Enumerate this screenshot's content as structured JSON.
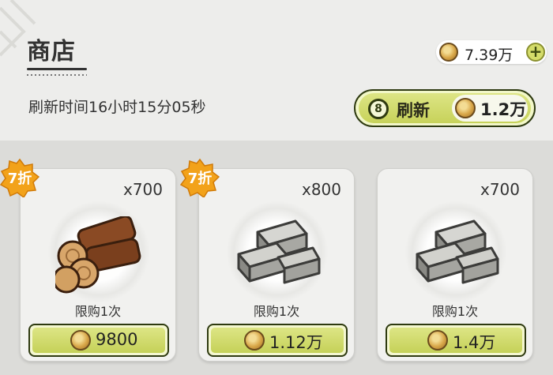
{
  "header": {
    "title": "商店",
    "currency_value": "7.39万",
    "refresh_time": "刷新时间16小时15分05秒"
  },
  "refresh_button": {
    "count": "8",
    "label": "刷新",
    "cost": "1.2万"
  },
  "items": [
    {
      "name": "wood-logs",
      "quantity": "x700",
      "limit": "限购1次",
      "price": "9800",
      "discount_label": "7折"
    },
    {
      "name": "stone-blocks",
      "quantity": "x800",
      "limit": "限购1次",
      "price": "1.12万",
      "discount_label": "7折"
    },
    {
      "name": "stone-blocks",
      "quantity": "x700",
      "limit": "限购1次",
      "price": "1.4万"
    }
  ],
  "colors": {
    "button_green": "#d2db6c",
    "button_border": "#2e3a10",
    "discount_orange": "#f2a21a",
    "coin_gold": "#d9a84a"
  }
}
